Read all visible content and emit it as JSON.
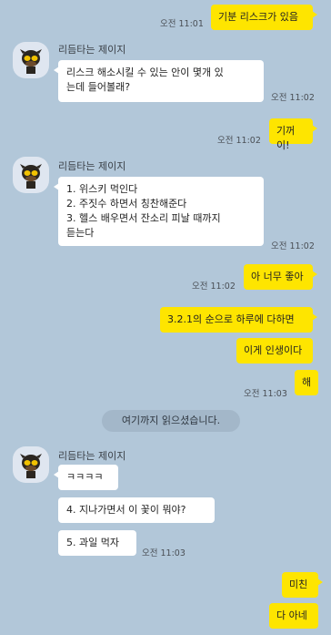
{
  "sender_name": "리듬타는 제이지",
  "messages": {
    "m1": {
      "text": "기분 리스크가 있음",
      "time": "오전 11:01"
    },
    "m2": {
      "text": "리스크 해소시킬 수 있는 안이 몇개 있\n는데 들어볼래?",
      "time": "오전 11:02"
    },
    "m3": {
      "text": "기꺼이!",
      "time": "오전 11:02"
    },
    "m4": {
      "text": "1. 위스키 먹인다\n2. 주짓수 하면서 칭찬해준다\n3. 헬스 배우면서 잔소리 피날 때까지\n듣는다",
      "time": "오전 11:02"
    },
    "m5": {
      "text": "아 너무 좋아",
      "time": "오전 11:02"
    },
    "m6": {
      "text": "3.2.1의 순으로 하루에 다하면"
    },
    "m7": {
      "text": "이게 인생이다"
    },
    "m8": {
      "text": "해",
      "time": "오전 11:03"
    },
    "m9": {
      "text": "ㅋㅋㅋㅋ"
    },
    "m10": {
      "text": "4. 지나가면서 이 꽃이 뭐야?"
    },
    "m11": {
      "text": "5. 과일 먹자",
      "time": "오전 11:03"
    },
    "m12": {
      "text": "미친"
    },
    "m13": {
      "text": "다 아네"
    }
  },
  "read_divider": "여기까지 읽으셨습니다.",
  "colors": {
    "background": "#b2c7d9",
    "my_bubble": "#fee500",
    "other_bubble": "#ffffff"
  },
  "avatar_icon": "dog-character-avatar-icon"
}
